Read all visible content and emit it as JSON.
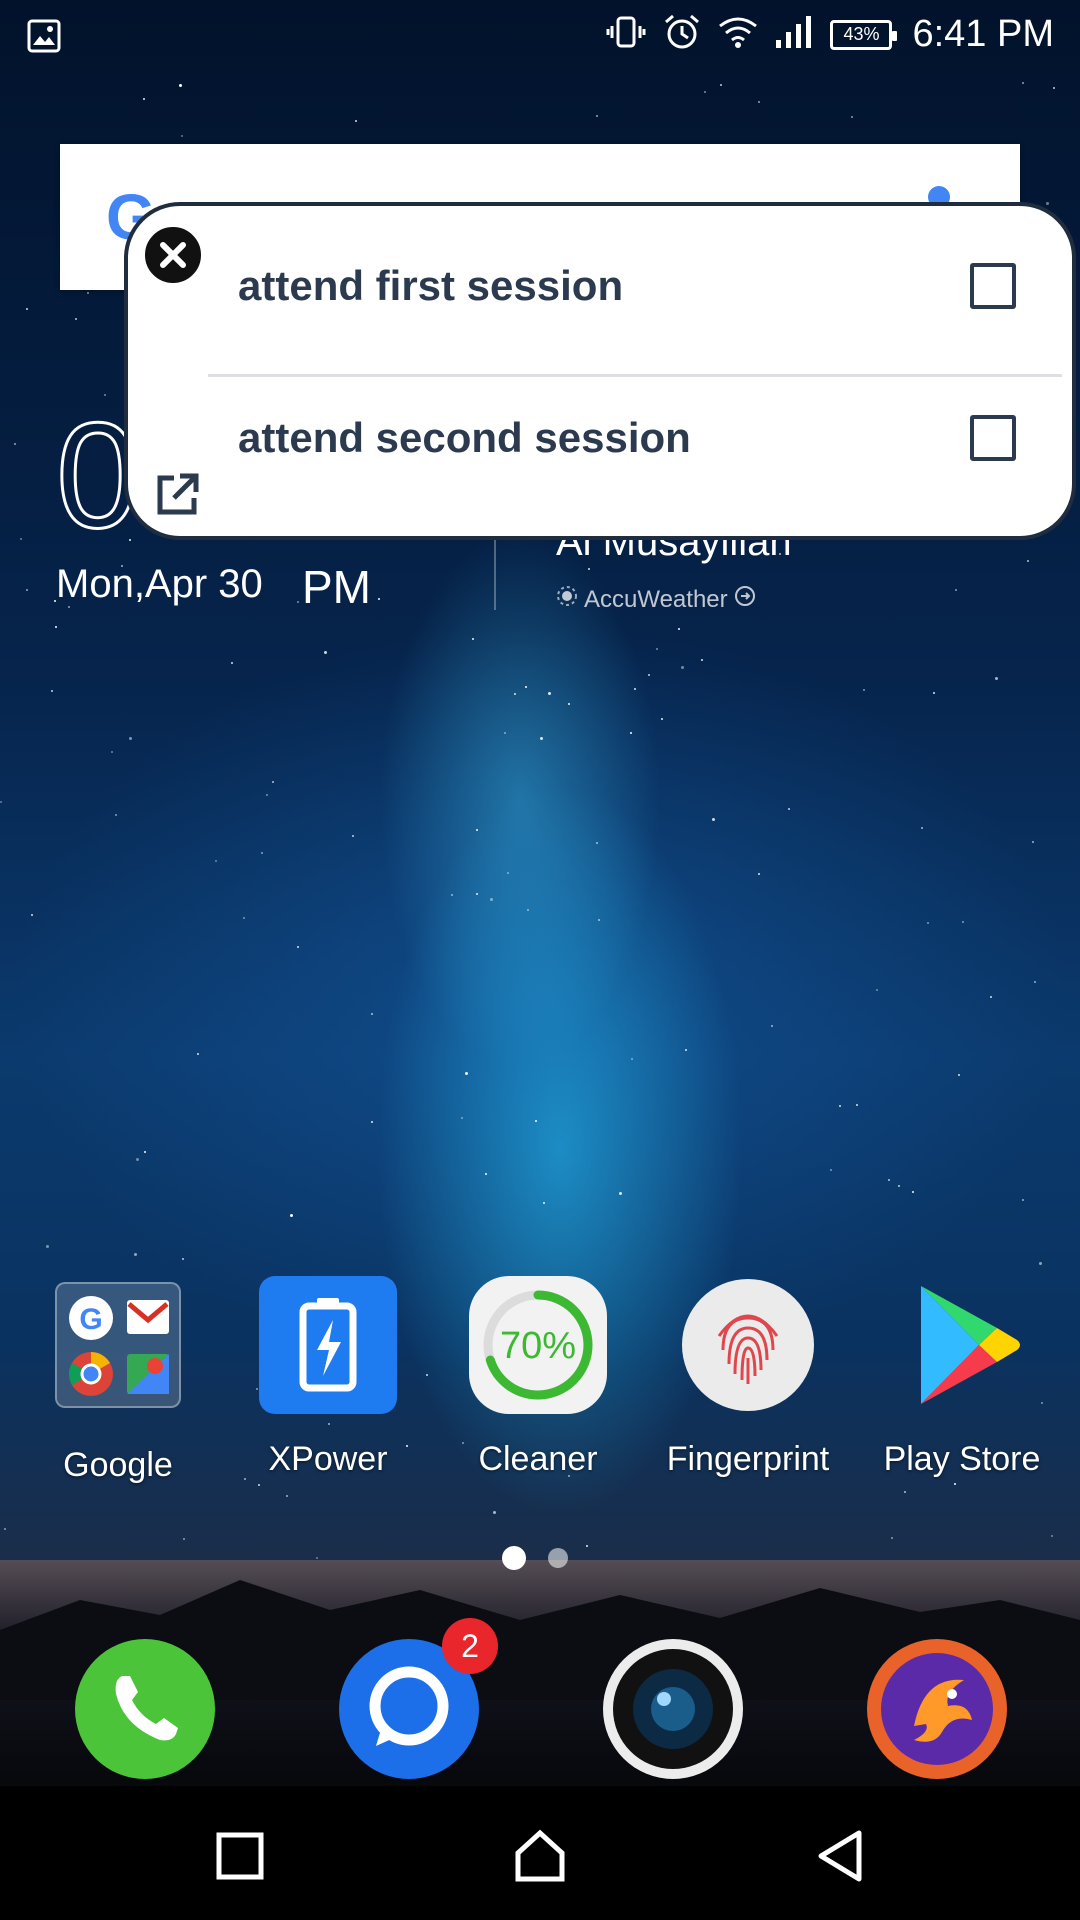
{
  "status_bar": {
    "battery_percent": "43%",
    "time": "6:41 PM",
    "icons": [
      "gallery-icon",
      "vibrate-icon",
      "alarm-icon",
      "wifi-icon",
      "signal-icon",
      "battery-icon"
    ]
  },
  "search_widget": {
    "logo": "G"
  },
  "clock_widget": {
    "date": "Mon,Apr 30",
    "ampm": "PM",
    "city": "Al Musayliiah",
    "provider": "AccuWeather"
  },
  "popup": {
    "items": [
      {
        "label": "attend first session",
        "checked": false
      },
      {
        "label": "attend second session",
        "checked": false
      }
    ]
  },
  "apps": [
    {
      "name": "Google"
    },
    {
      "name": "XPower"
    },
    {
      "name": "Cleaner",
      "percent": "70%"
    },
    {
      "name": "Fingerprint"
    },
    {
      "name": "Play Store"
    }
  ],
  "dock": {
    "messages_badge": "2"
  },
  "colors": {
    "popup_text": "#2c3a4f",
    "phone_green": "#4cc43a",
    "messages_blue": "#1c6fe8",
    "badge_red": "#e8262b"
  }
}
